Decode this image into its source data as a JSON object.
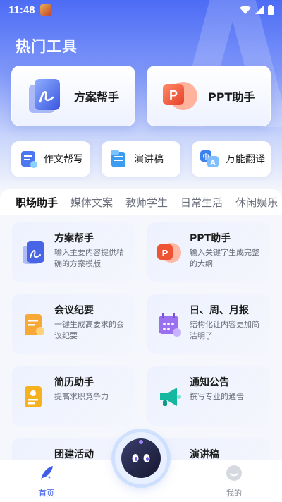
{
  "status": {
    "time": "11:48"
  },
  "header": {
    "title": "热门工具"
  },
  "featured": [
    {
      "label": "方案帮手",
      "icon": "document-pen-icon"
    },
    {
      "label": "PPT助手",
      "icon": "powerpoint-icon"
    }
  ],
  "tools": [
    {
      "label": "作文帮写",
      "icon": "writing-icon"
    },
    {
      "label": "演讲稿",
      "icon": "speech-doc-icon"
    },
    {
      "label": "万能翻译",
      "icon": "translate-icon"
    }
  ],
  "tabs": [
    "职场助手",
    "媒体文案",
    "教师学生",
    "日常生活",
    "休闲娱乐"
  ],
  "active_tab": "职场助手",
  "items": [
    {
      "title": "方案帮手",
      "desc": "输入主要内容提供精确的方案模版",
      "icon": "document-pen-icon"
    },
    {
      "title": "PPT助手",
      "desc": "输入关键字生成完整的大纲",
      "icon": "powerpoint-icon"
    },
    {
      "title": "会议纪要",
      "desc": "一键生成高要求的会议纪要",
      "icon": "meeting-notes-icon"
    },
    {
      "title": "日、周、月报",
      "desc": "结构化让内容更加简洁明了",
      "icon": "calendar-icon"
    },
    {
      "title": "简历助手",
      "desc": "提高求职竞争力",
      "icon": "resume-icon"
    },
    {
      "title": "通知公告",
      "desc": "撰写专业的通告",
      "icon": "megaphone-icon"
    },
    {
      "title": "团建活动",
      "desc": "",
      "icon": "team-icon"
    },
    {
      "title": "演讲稿",
      "desc": "",
      "icon": "speech-doc-icon"
    }
  ],
  "nav": [
    {
      "label": "首页",
      "icon": "feather-home-icon",
      "active": true
    },
    {
      "label": "我的",
      "icon": "profile-face-icon",
      "active": false
    }
  ],
  "colors": {
    "accent": "#4c6cf5",
    "nav_active": "#3f5ee8",
    "nav_inactive": "#8a8f99"
  }
}
